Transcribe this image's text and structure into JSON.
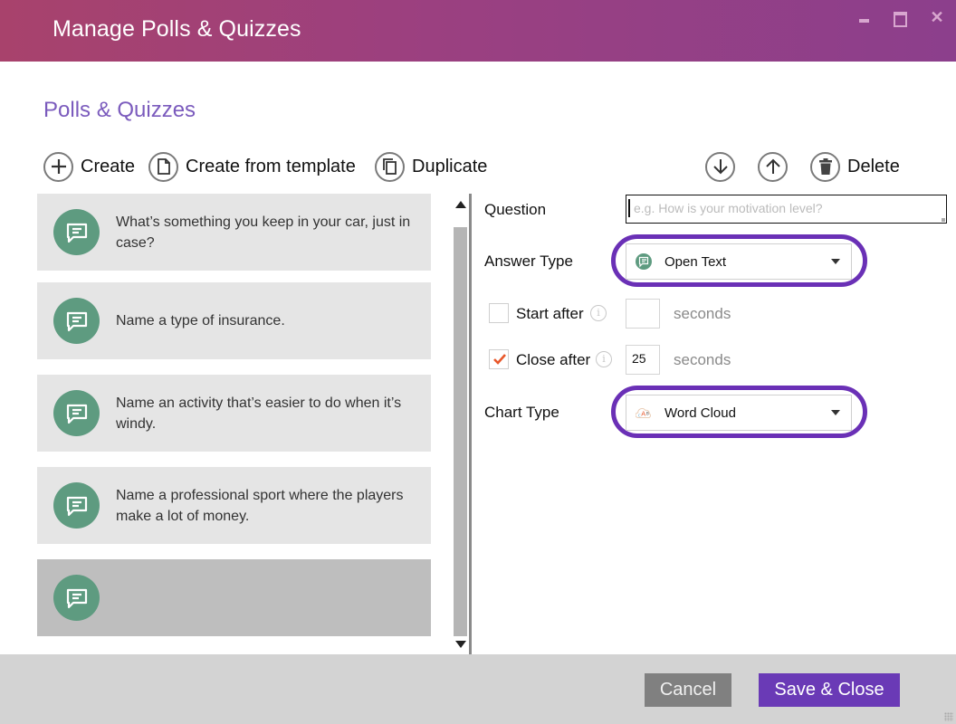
{
  "window": {
    "title": "Manage Polls & Quizzes",
    "controls": {
      "minimize": "minimize",
      "maximize": "maximize",
      "close": "✕"
    }
  },
  "section_title": "Polls & Quizzes",
  "toolbar": {
    "create_label": "Create",
    "create_template_label": "Create from template",
    "duplicate_label": "Duplicate",
    "delete_label": "Delete"
  },
  "questions": [
    {
      "text": "What’s something you keep in your car, just in case?",
      "icon": "speech-bubble-icon",
      "selected": false
    },
    {
      "text": "Name a type of insurance.",
      "icon": "speech-bubble-icon",
      "selected": false
    },
    {
      "text": "Name an activity that’s easier to do when it’s windy.",
      "icon": "speech-bubble-icon",
      "selected": false
    },
    {
      "text": "Name a professional sport where the players make a lot of money.",
      "icon": "speech-bubble-icon",
      "selected": false
    },
    {
      "text": "",
      "icon": "speech-bubble-icon",
      "selected": true
    }
  ],
  "form": {
    "question_label": "Question",
    "question_value": "",
    "question_placeholder": "e.g. How is your motivation level?",
    "answer_type_label": "Answer Type",
    "answer_type_value": "Open Text",
    "start_after_label": "Start after",
    "start_after_checked": false,
    "start_after_value": "",
    "close_after_label": "Close after",
    "close_after_checked": true,
    "close_after_value": "25",
    "seconds_label": "seconds",
    "chart_type_label": "Chart Type",
    "chart_type_value": "Word Cloud"
  },
  "footer": {
    "cancel_label": "Cancel",
    "save_label": "Save & Close"
  },
  "colors": {
    "accent": "#6a3ab6",
    "highlight_ring": "#6a30b6",
    "section_title": "#7b5bbd",
    "question_icon": "#5e9b80",
    "checkmark": "#e8572a",
    "titlebar_start": "#a8426c",
    "titlebar_end": "#8c3f8c"
  }
}
